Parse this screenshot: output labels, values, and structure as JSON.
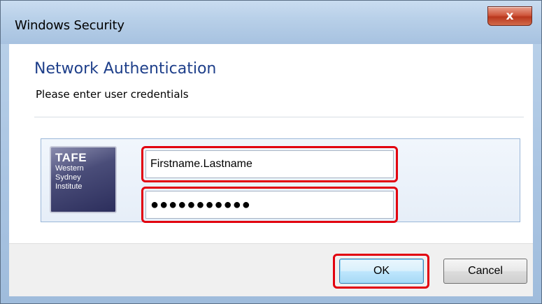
{
  "window": {
    "title": "Windows Security",
    "close_label": "x"
  },
  "dialog": {
    "heading": "Network Authentication",
    "subheading": "Please enter user credentials"
  },
  "logo": {
    "line1": "TAFE",
    "line2": "Western",
    "line3": "Sydney",
    "line4": "Institute"
  },
  "credentials": {
    "username_value": "Firstname.Lastname",
    "password_masked": "●●●●●●●●●●●"
  },
  "buttons": {
    "ok_label": "OK",
    "cancel_label": "Cancel"
  },
  "colors": {
    "heading": "#1e3f8a",
    "highlight": "#e2000f",
    "panel_border": "#9bb7d8"
  }
}
